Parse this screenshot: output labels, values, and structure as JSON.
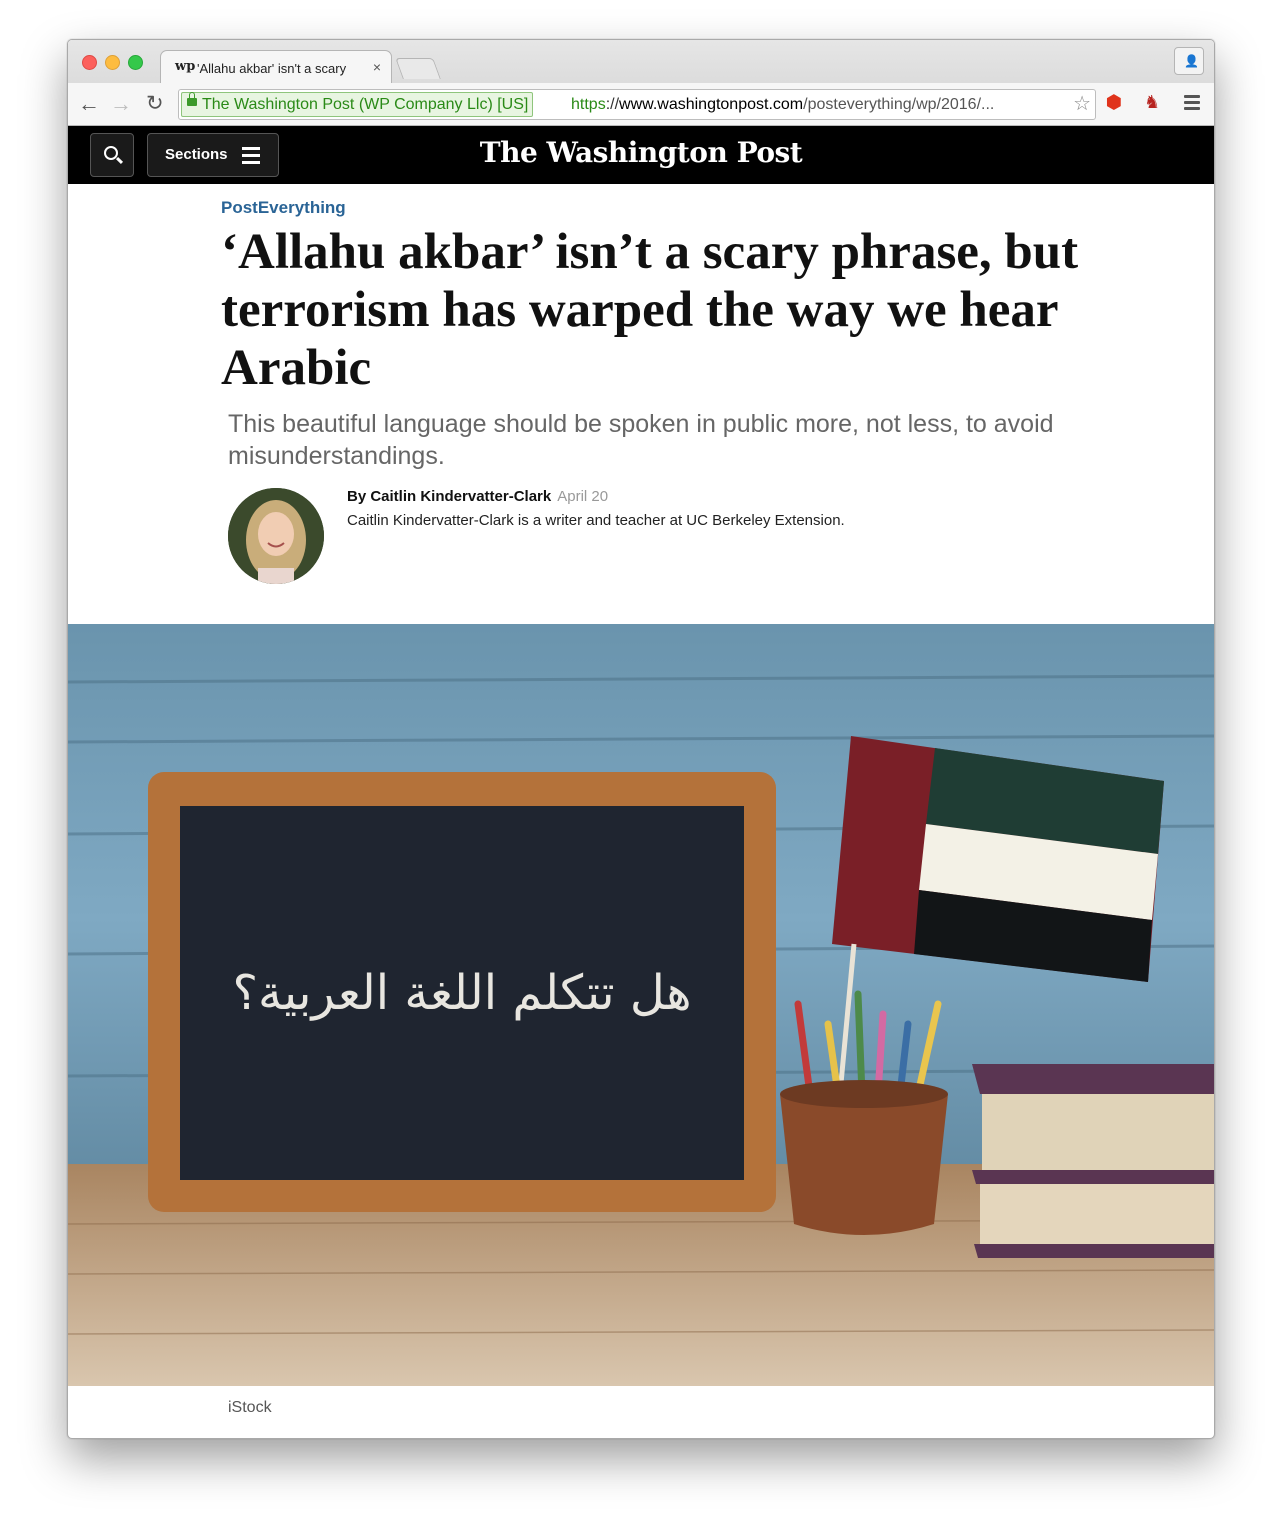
{
  "browser": {
    "tab_logo": "wp",
    "tab_title": "'Allahu akbar' isn't a scary",
    "tab_close": "×",
    "ev_label": "The Washington Post (WP Company Llc) [US]",
    "url_scheme": "https",
    "url_sep": "://",
    "url_host": "www.washingtonpost.com",
    "url_path": "/posteverything/wp/2016/..."
  },
  "header": {
    "sections_label": "Sections",
    "masthead": "The Washington Post"
  },
  "article": {
    "kicker": "PostEverything",
    "headline": "‘Allahu akbar’ isn’t a scary phrase, but terrorism has warped the way we hear Arabic",
    "dek": "This beautiful language should be spoken in public more, not less, to avoid misunderstandings.",
    "byline": {
      "author": "By Caitlin Kindervatter-Clark",
      "date": "April 20",
      "bio": "Caitlin Kindervatter-Clark is a writer and teacher at UC Berkeley Extension."
    },
    "image": {
      "chalkboard_text": "هل تتكلم اللغة العربية؟",
      "caption": "iStock"
    }
  },
  "colors": {
    "kicker": "#2a6496",
    "masthead_bg": "#000000",
    "ev_green": "#2a8a17"
  }
}
